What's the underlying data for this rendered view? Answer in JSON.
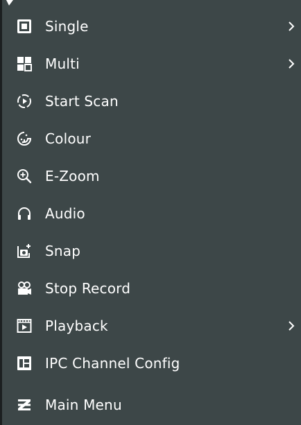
{
  "menu": {
    "items": [
      {
        "label": "Single",
        "icon": "single-view-icon",
        "submenu": true
      },
      {
        "label": "Multi",
        "icon": "multi-view-icon",
        "submenu": true
      },
      {
        "label": "Start Scan",
        "icon": "scan-icon",
        "submenu": false
      },
      {
        "label": "Colour",
        "icon": "colour-icon",
        "submenu": false
      },
      {
        "label": "E-Zoom",
        "icon": "zoom-in-icon",
        "submenu": false
      },
      {
        "label": "Audio",
        "icon": "headphones-icon",
        "submenu": false
      },
      {
        "label": "Snap",
        "icon": "snapshot-icon",
        "submenu": false
      },
      {
        "label": "Stop Record",
        "icon": "record-camera-icon",
        "submenu": false
      },
      {
        "label": "Playback",
        "icon": "playback-icon",
        "submenu": true
      },
      {
        "label": "IPC Channel Config",
        "icon": "ipc-channel-icon",
        "submenu": false
      },
      {
        "label": "Main Menu",
        "icon": "main-menu-icon",
        "submenu": false
      }
    ],
    "colors": {
      "background": "#3d4748",
      "text": "#ffffff"
    }
  }
}
